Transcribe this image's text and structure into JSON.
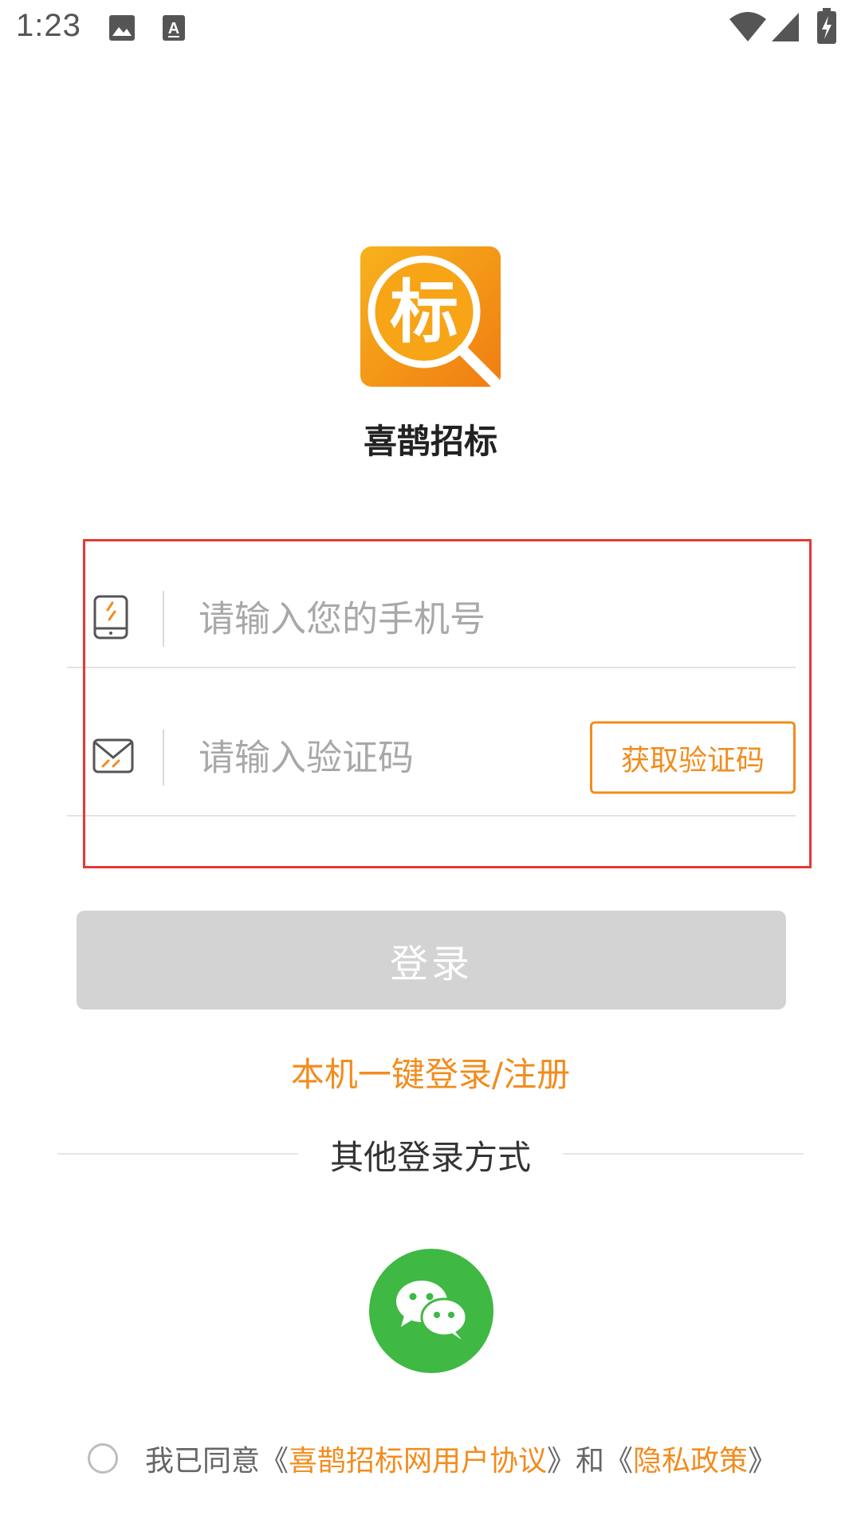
{
  "status_bar": {
    "time": "1:23",
    "icons": [
      "image-icon",
      "a-notification-icon",
      "wifi-icon",
      "cellular-signal-icon",
      "battery-charging-icon"
    ]
  },
  "app": {
    "name": "喜鹊招标",
    "logo_char": "标",
    "colors": {
      "accent": "#f28c1e",
      "logo_orange": "#f59a1a",
      "wechat_green": "#3fb844",
      "button_disabled": "#d3d3d3",
      "highlight": "#e53935"
    }
  },
  "form": {
    "phone_placeholder": "请输入您的手机号",
    "phone_value": "",
    "code_placeholder": "请输入验证码",
    "code_value": "",
    "get_code_label": "获取验证码",
    "login_label": "登录"
  },
  "one_key_login": "本机一键登录/注册",
  "other_login": {
    "label": "其他登录方式",
    "methods": [
      "wechat"
    ]
  },
  "agreement": {
    "prefix": "我已同意《",
    "user_agreement": "喜鹊招标网用户协议",
    "middle": "》和《",
    "privacy_policy": "隐私政策",
    "suffix": "》",
    "checked": false
  }
}
